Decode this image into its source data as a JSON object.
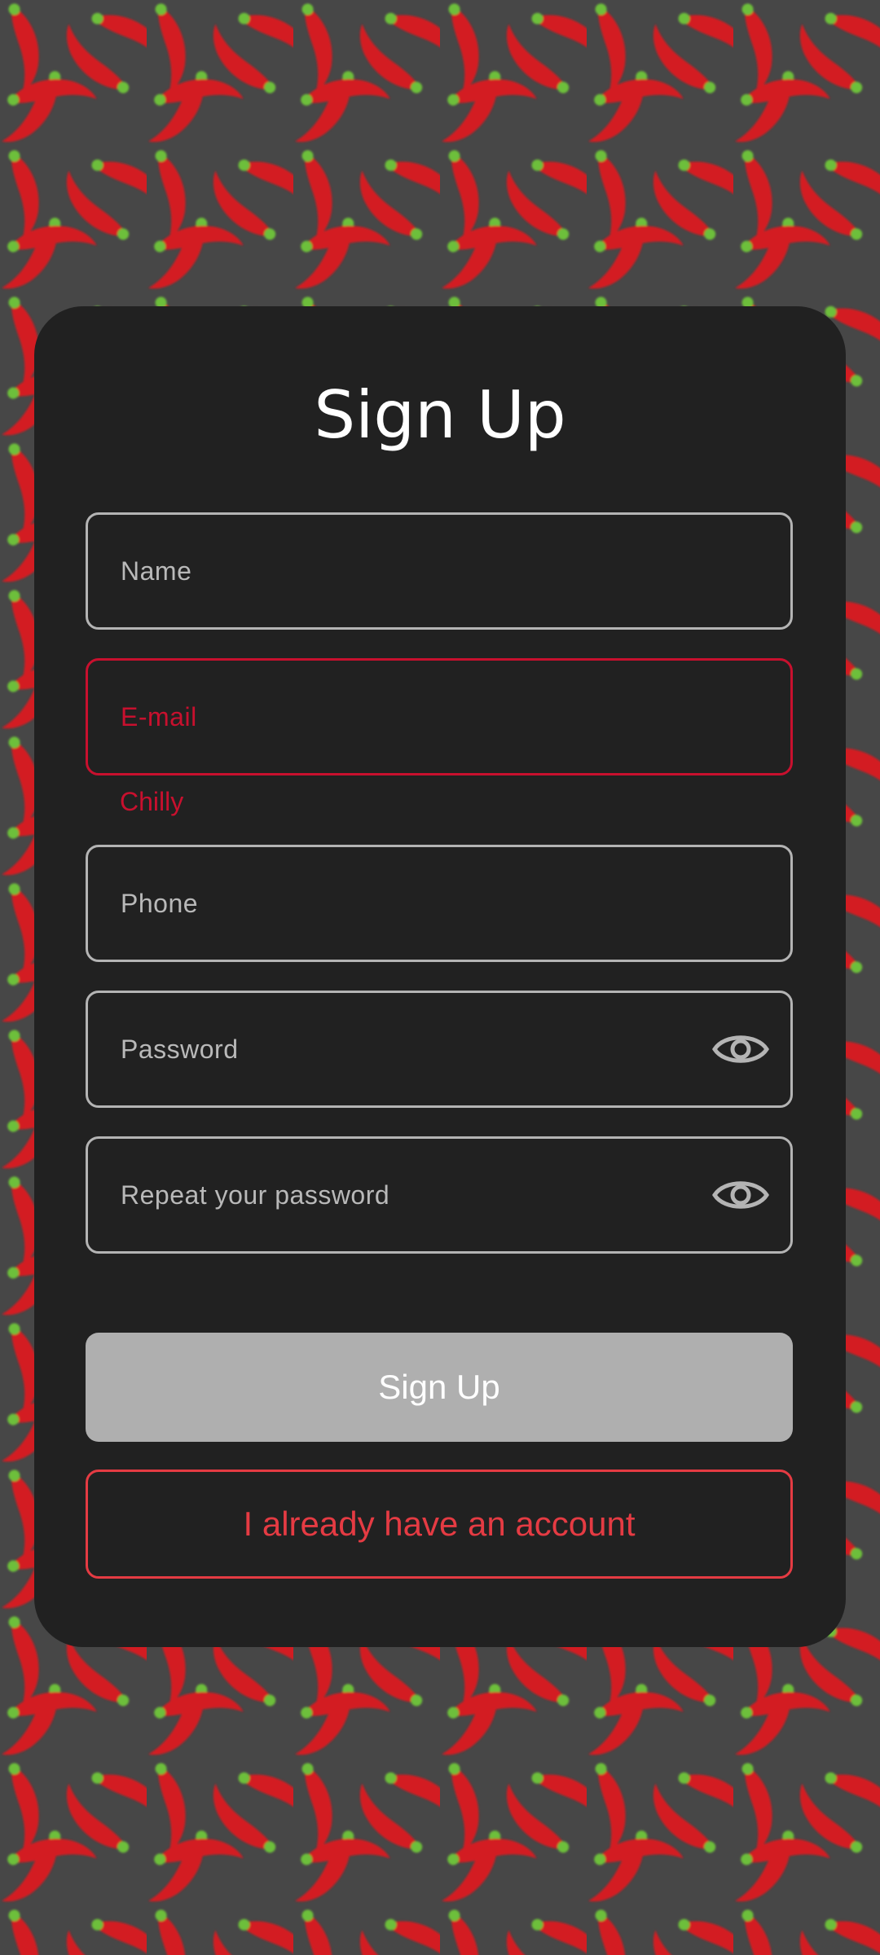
{
  "colors": {
    "background": "#474747",
    "card": "#212121",
    "field_border": "#b4b4b4",
    "field_text": "#b9b9b9",
    "error": "#c8102e",
    "primary_button": "#afafaf",
    "accent": "#e53b43",
    "chili_red": "#d31a24",
    "chili_stem": "#6dbf3a"
  },
  "form": {
    "title": "Sign Up",
    "fields": [
      {
        "name": "name",
        "placeholder": "Name",
        "state": "normal"
      },
      {
        "name": "email",
        "placeholder": "E-mail",
        "state": "error",
        "error_text": "Chilly"
      },
      {
        "name": "phone",
        "placeholder": "Phone",
        "state": "normal"
      },
      {
        "name": "password",
        "placeholder": "Password",
        "state": "normal",
        "icon": "eye-icon"
      },
      {
        "name": "repeat_password",
        "placeholder": "Repeat your password",
        "state": "normal",
        "icon": "eye-icon"
      }
    ],
    "submit_label": "Sign Up",
    "login_label": "I already have an account"
  }
}
